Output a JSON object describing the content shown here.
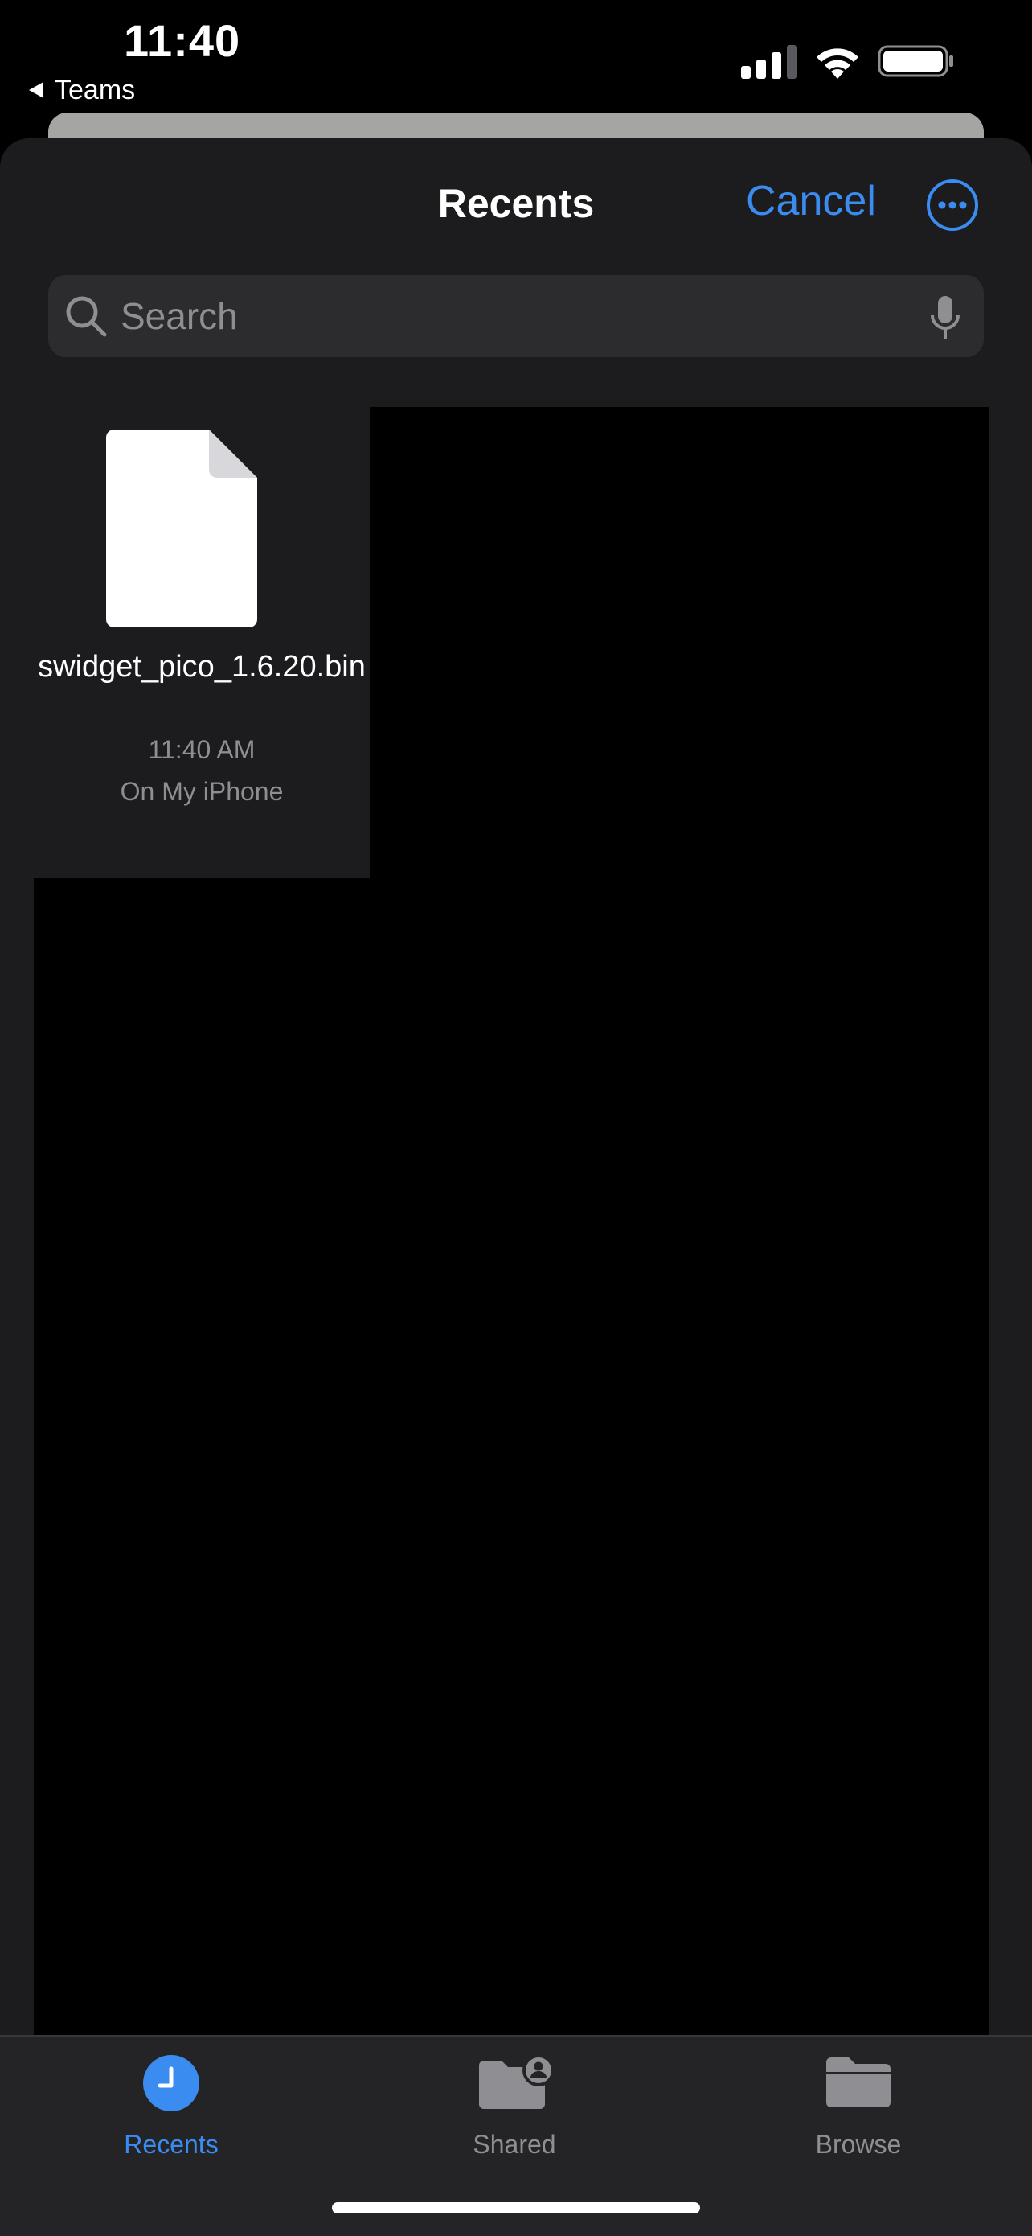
{
  "status_bar": {
    "time": "11:40",
    "back_app": "Teams",
    "icons": [
      "signal-icon",
      "wifi-icon",
      "battery-icon"
    ]
  },
  "nav": {
    "title": "Recents",
    "cancel_label": "Cancel",
    "more_icon": "ellipsis-circle-icon"
  },
  "search": {
    "placeholder": "Search",
    "value": "",
    "icons": [
      "magnifier-icon",
      "microphone-icon"
    ]
  },
  "files": [
    {
      "name": "swidget_pico_1.6.20.bin",
      "time": "11:40 AM",
      "location": "On My iPhone",
      "icon": "document-icon"
    }
  ],
  "tabs": [
    {
      "label": "Recents",
      "icon": "clock-icon",
      "active": true
    },
    {
      "label": "Shared",
      "icon": "shared-folder-icon",
      "active": false
    },
    {
      "label": "Browse",
      "icon": "folder-icon",
      "active": false
    }
  ],
  "colors": {
    "accent": "#3b8cf0",
    "sheet_background": "#1c1c1e",
    "search_background": "#2c2c2f",
    "tab_bar_background": "#242426",
    "secondary_text": "#8e8e93"
  }
}
